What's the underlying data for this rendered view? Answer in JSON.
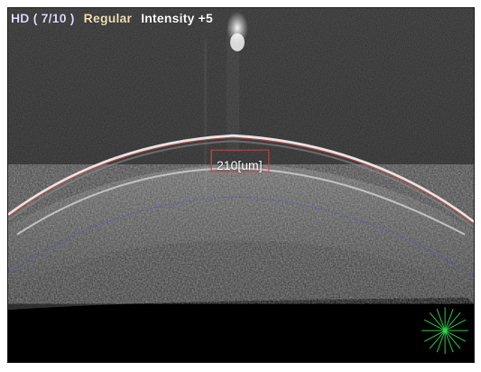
{
  "header": {
    "hd": "HD ( 7/10 )",
    "mode": "Regular",
    "intensity": "Intensity +5"
  },
  "measurement": {
    "thickness_label": "210[um]",
    "thickness_um": 210
  },
  "colors": {
    "hd_text": "#d9dcff",
    "mode_text": "#f0e2b6",
    "intensity_text": "#ffffff",
    "outer_boundary": "#c44747",
    "inner_boundary": "#4d53c7",
    "caliper": "#c44747",
    "compass_rays": "#2fd64a"
  },
  "icons": {
    "compass": "radial-green-compass-icon"
  }
}
